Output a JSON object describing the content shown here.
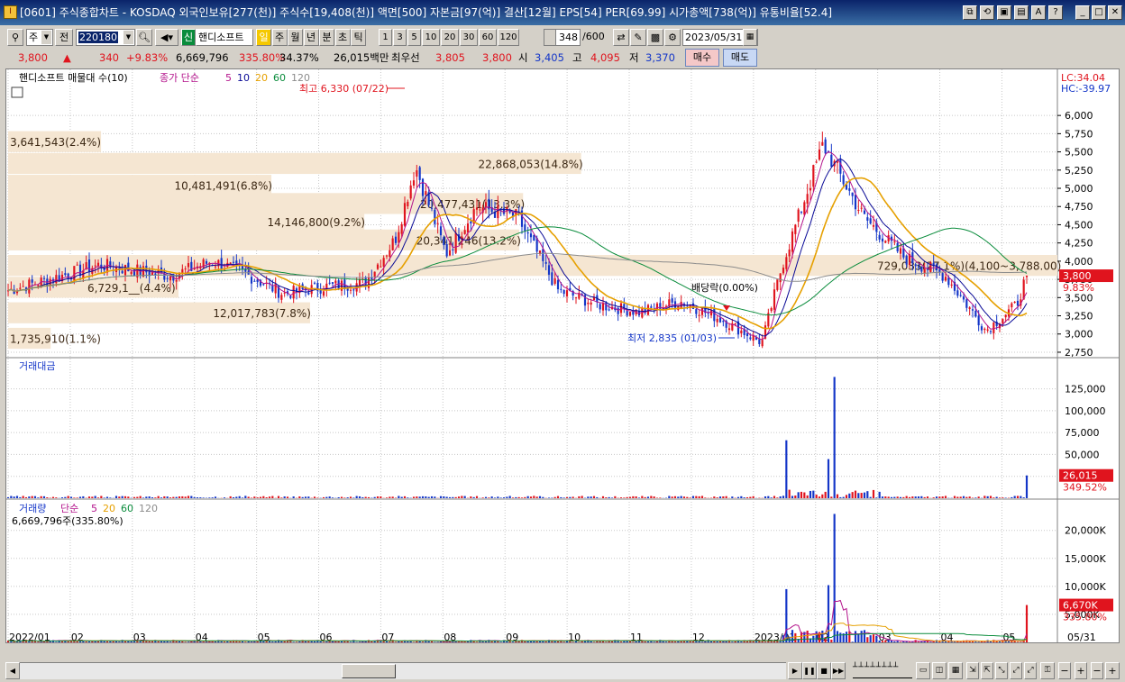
{
  "window": {
    "title": "[0601] 주식종합차트 - KOSDAQ 외국인보유[277(천)] 주식수[19,408(천)] 액면[500] 자본금[97(억)] 결산[12월] EPS[54] PER[69.99] 시가총액[738(억)] 유통비율[52.4]",
    "app_icon": "I"
  },
  "toolbar": {
    "type_select": "주",
    "prev_label": "전",
    "code": "220180",
    "badge": "신",
    "stock_name": "핸디소프트",
    "period_tabs": [
      "일",
      "주",
      "월",
      "년",
      "분",
      "초",
      "틱"
    ],
    "active_period": "일",
    "num_tabs": [
      "1",
      "3",
      "5",
      "10",
      "20",
      "30",
      "60",
      "120"
    ],
    "count": "348",
    "count_total": "/600",
    "date": "2023/05/31"
  },
  "quote": {
    "price": "3,800",
    "arrow": "▲",
    "change": "340",
    "pct": "+9.83%",
    "volume": "6,669,796",
    "vol_ratio": "335.80%",
    "turnover": "34.37%",
    "amount": "26,015백만",
    "bid_label": "최우선",
    "ask1": "3,805",
    "bid1": "3,800",
    "open_label": "시",
    "open": "3,405",
    "high_label": "고",
    "high": "4,095",
    "low_label": "저",
    "low": "3,370",
    "buy_label": "매수",
    "sell_label": "매도"
  },
  "legend": {
    "volume_profile": "핸디소프트 매물대 수(10)",
    "ma_prefix": "종가 단순",
    "ma_periods": [
      "5",
      "10",
      "20",
      "60",
      "120"
    ],
    "lc": "LC:34.04",
    "hc": "HC:-39.97",
    "amount_panel": "거래대금",
    "volume_panel_title": "거래량",
    "volume_panel_ma": "단순",
    "volume_panel_periods": [
      "5",
      "20",
      "60",
      "120"
    ],
    "volume_panel_value": "6,669,796주(335.80%)"
  },
  "annotations": {
    "high": "최고 6,330 (07/22)",
    "low": "최저 2,835 (01/03)",
    "dividend": "배당락(0.00%)"
  },
  "colors": {
    "up": "#e0141e",
    "down": "#1436c8",
    "ma5": "#b4148c",
    "ma10": "#0a0a96",
    "ma20": "#e6a000",
    "ma60": "#0a8c3c",
    "ma120": "#8c8c8c",
    "profile": "#f5e6d2"
  },
  "chart_data": {
    "type": "candlestick",
    "x_axis": {
      "labels": [
        "2022/01",
        "02",
        "03",
        "04",
        "05",
        "06",
        "07",
        "08",
        "09",
        "10",
        "11",
        "12",
        "2023/01",
        "02",
        "03",
        "04",
        "05",
        "05/31"
      ]
    },
    "price_axis": {
      "ticks": [
        "6,000",
        "5,750",
        "5,500",
        "5,250",
        "5,000",
        "4,750",
        "4,500",
        "4,250",
        "4,000",
        "3,750",
        "3,500",
        "3,250",
        "3,000",
        "2,750"
      ],
      "current": "3,800",
      "current_pct": "9.83%"
    },
    "volume_profile": [
      {
        "label": "1,735,910(1.1%)",
        "price": 2935,
        "pct": 1.1
      },
      {
        "label": "12,017,783(7.8%)",
        "price": 3285,
        "pct": 7.8
      },
      {
        "label": "6,729,1__(4.4%)",
        "price": 3635,
        "pct": 4.4
      },
      {
        "label": "20,341,246(13.2%)",
        "price": 4285,
        "pct": 13.2
      },
      {
        "label": "20,477,431(13.3%)",
        "price": 4785,
        "pct": 13.3
      },
      {
        "label": "729,033(27.1%)(4,100~3,788.00)",
        "price": 3935,
        "pct": 27.1
      },
      {
        "label": "14,146,800(9.2%)",
        "price": 4535,
        "pct": 9.2
      },
      {
        "label": "10,481,491(6.8%)",
        "price": 5035,
        "pct": 6.8
      },
      {
        "label": "22,868,053(14.8%)",
        "price": 5335,
        "pct": 14.8
      },
      {
        "label": "3,641,543(2.4%)",
        "price": 5635,
        "pct": 2.4
      }
    ],
    "key_closes": [
      {
        "t": 0,
        "v": 3600
      },
      {
        "t": 0.04,
        "v": 3750
      },
      {
        "t": 0.09,
        "v": 3950
      },
      {
        "t": 0.16,
        "v": 3800
      },
      {
        "t": 0.2,
        "v": 4000
      },
      {
        "t": 0.23,
        "v": 3850
      },
      {
        "t": 0.27,
        "v": 3550
      },
      {
        "t": 0.31,
        "v": 3650
      },
      {
        "t": 0.35,
        "v": 3700
      },
      {
        "t": 0.38,
        "v": 4300
      },
      {
        "t": 0.4,
        "v": 5300
      },
      {
        "t": 0.43,
        "v": 4100
      },
      {
        "t": 0.46,
        "v": 4750
      },
      {
        "t": 0.5,
        "v": 4600
      },
      {
        "t": 0.54,
        "v": 3600
      },
      {
        "t": 0.58,
        "v": 3400
      },
      {
        "t": 0.62,
        "v": 3300
      },
      {
        "t": 0.66,
        "v": 3450
      },
      {
        "t": 0.7,
        "v": 3200
      },
      {
        "t": 0.74,
        "v": 2880
      },
      {
        "t": 0.76,
        "v": 3950
      },
      {
        "t": 0.8,
        "v": 5600
      },
      {
        "t": 0.84,
        "v": 4600
      },
      {
        "t": 0.88,
        "v": 4050
      },
      {
        "t": 0.92,
        "v": 3800
      },
      {
        "t": 0.96,
        "v": 3050
      },
      {
        "t": 0.99,
        "v": 3400
      },
      {
        "t": 1,
        "v": 3800
      }
    ],
    "amount_panel": {
      "ticks": [
        "125,000",
        "100,000",
        "75,000",
        "50,000",
        "25,000"
      ],
      "current": "26,015",
      "current_pct": "349.52%",
      "spikes": [
        {
          "t": 0.765,
          "v": 58000
        },
        {
          "t": 0.81,
          "v": 130000
        },
        {
          "t": 0.805,
          "v": 40000
        },
        {
          "t": 1,
          "v": 26015
        }
      ]
    },
    "volume_panel": {
      "ticks": [
        "20,000K",
        "15,000K",
        "10,000K",
        "5,000K"
      ],
      "current": "6,670K",
      "current_pct": "335.80%",
      "spikes": [
        {
          "t": 0.765,
          "v": 8000
        },
        {
          "t": 0.81,
          "v": 22000
        },
        {
          "t": 0.805,
          "v": 9000
        },
        {
          "t": 1,
          "v": 6670
        }
      ]
    }
  }
}
